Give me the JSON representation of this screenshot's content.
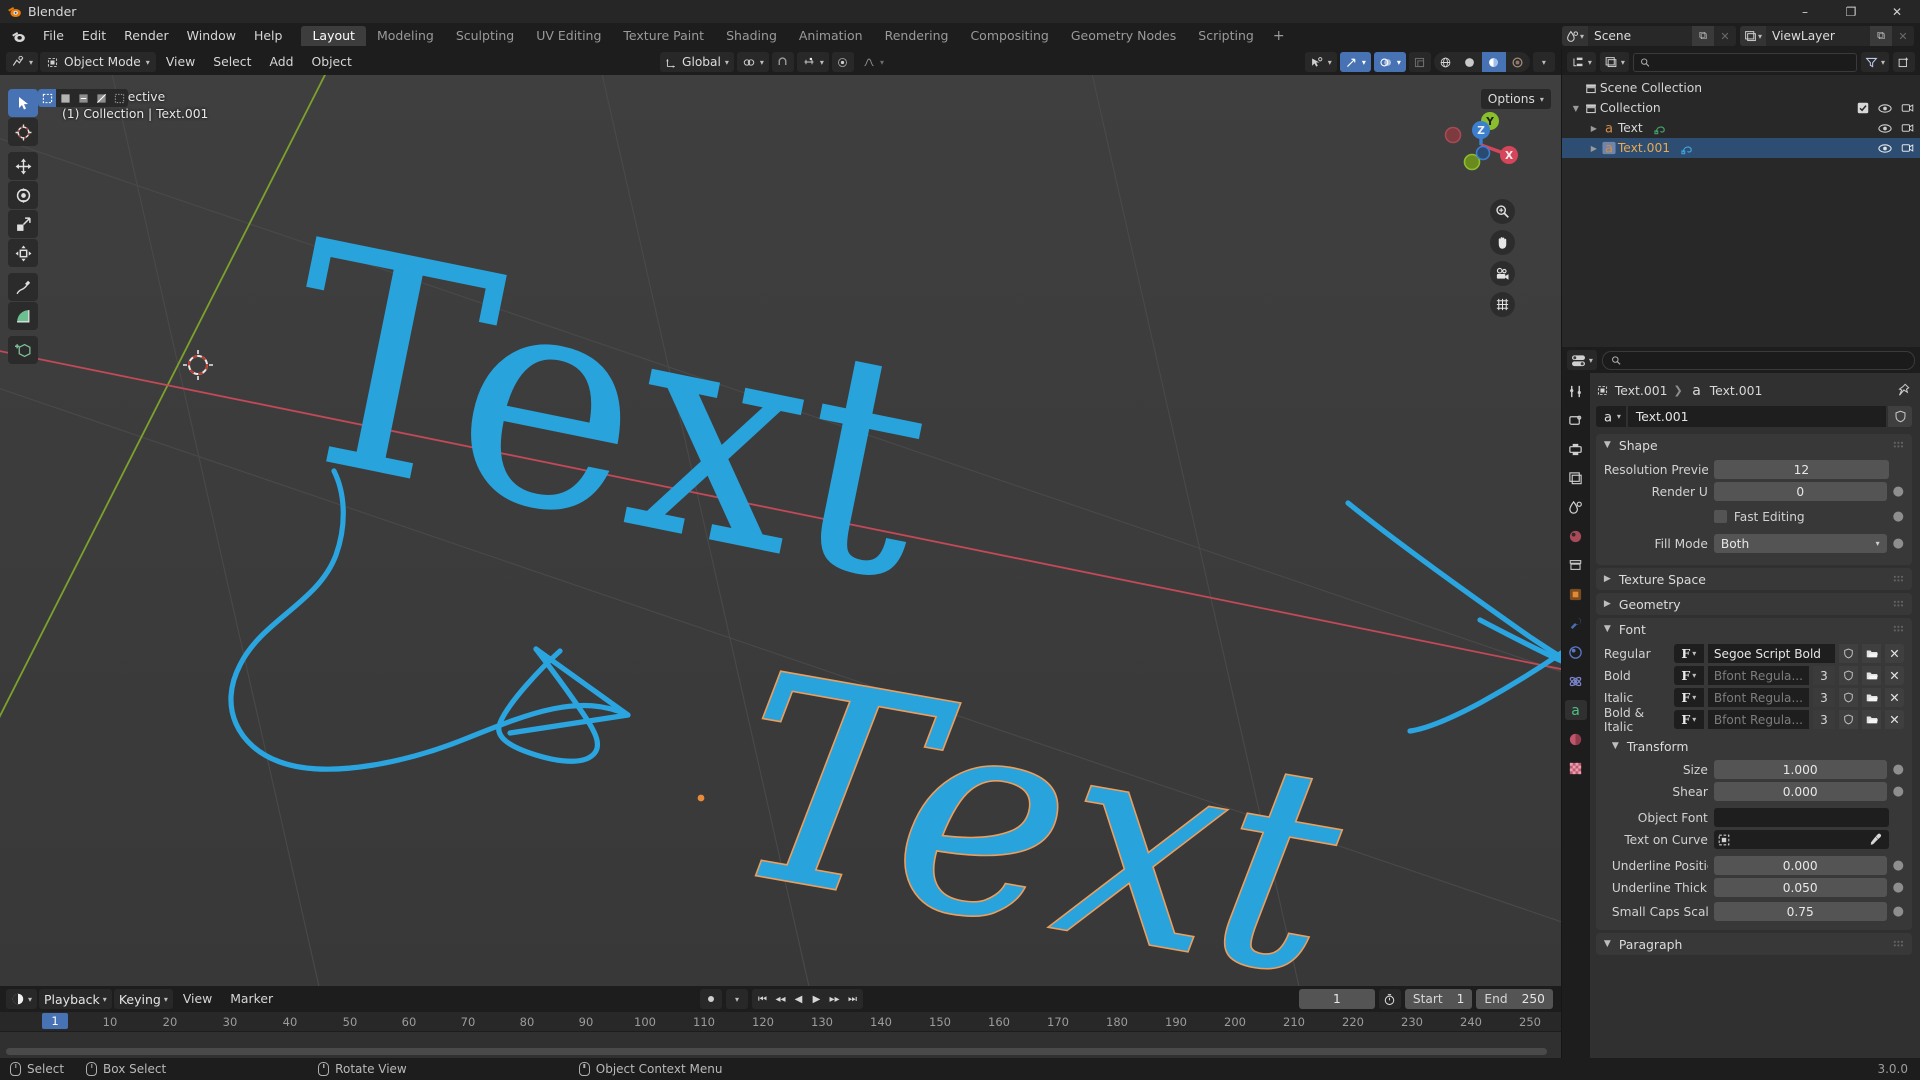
{
  "window": {
    "app_title": "Blender",
    "minimize": "–",
    "maximize": "❐",
    "close": "✕"
  },
  "topbar": {
    "menus": [
      "File",
      "Edit",
      "Render",
      "Window",
      "Help"
    ],
    "workspace_tabs": [
      {
        "label": "Layout",
        "active": true
      },
      {
        "label": "Modeling",
        "active": false
      },
      {
        "label": "Sculpting",
        "active": false
      },
      {
        "label": "UV Editing",
        "active": false
      },
      {
        "label": "Texture Paint",
        "active": false
      },
      {
        "label": "Shading",
        "active": false
      },
      {
        "label": "Animation",
        "active": false
      },
      {
        "label": "Rendering",
        "active": false
      },
      {
        "label": "Compositing",
        "active": false
      },
      {
        "label": "Geometry Nodes",
        "active": false
      },
      {
        "label": "Scripting",
        "active": false
      }
    ],
    "add_workspace": "+",
    "scene_name": "Scene",
    "viewlayer_name": "ViewLayer",
    "new_btn": "⧉",
    "unlink_btn": "✕"
  },
  "viewport": {
    "mode": "Object Mode",
    "menus": [
      "View",
      "Select",
      "Add",
      "Object"
    ],
    "transform_orientation": "Global",
    "overlay_line1": "User Perspective",
    "overlay_line2": "(1) Collection | Text.001",
    "options_label": "Options",
    "gizmo_axes": {
      "x": "X",
      "y": "Y",
      "z": "Z"
    },
    "tools": [
      "tweak-select-tool",
      "cursor-tool",
      "move-tool",
      "rotate-tool",
      "scale-tool",
      "transform-tool",
      "annotate-tool",
      "measure-tool",
      "add-cube-tool"
    ],
    "nav_buttons": [
      "zoom-icon",
      "pan-hand-icon",
      "camera-icon",
      "grid-ortho-icon"
    ]
  },
  "outliner": {
    "search_placeholder": "",
    "rows": [
      {
        "label": "Scene Collection",
        "icon": "collection-icon",
        "depth": 0,
        "selected": false,
        "has_toggle": false,
        "checkbox": false,
        "eye": false,
        "camera": false
      },
      {
        "label": "Collection",
        "icon": "collection-icon",
        "depth": 1,
        "selected": false,
        "has_toggle": true,
        "checkbox": true,
        "eye": true,
        "camera": true
      },
      {
        "label": "Text",
        "icon": "font-a-icon",
        "depth": 2,
        "selected": false,
        "has_toggle": true,
        "checkbox": false,
        "eye": true,
        "camera": true
      },
      {
        "label": "Text.001",
        "icon": "font-a-icon",
        "depth": 2,
        "selected": true,
        "has_toggle": true,
        "checkbox": false,
        "eye": true,
        "camera": true
      }
    ]
  },
  "properties": {
    "search_placeholder": "",
    "breadcrumb": {
      "object": "Text.001",
      "data": "Text.001"
    },
    "id_name": "Text.001",
    "panels": {
      "shape": {
        "title": "Shape",
        "resolution_preview_label": "Resolution Previe...",
        "resolution_preview_value": "12",
        "render_u_label": "Render U",
        "render_u_value": "0",
        "fast_editing_label": "Fast Editing",
        "fill_mode_label": "Fill Mode",
        "fill_mode_value": "Both"
      },
      "texture_space": {
        "title": "Texture Space"
      },
      "geometry": {
        "title": "Geometry"
      },
      "font": {
        "title": "Font",
        "rows": [
          {
            "label": "Regular",
            "value": "Segoe Script Bold",
            "users": "",
            "dim": false
          },
          {
            "label": "Bold",
            "value": "Bfont Regula...",
            "users": "3",
            "dim": true
          },
          {
            "label": "Italic",
            "value": "Bfont Regula...",
            "users": "3",
            "dim": true
          },
          {
            "label": "Bold & Italic",
            "value": "Bfont Regula...",
            "users": "3",
            "dim": true
          }
        ]
      },
      "transform": {
        "title": "Transform",
        "size_label": "Size",
        "size_value": "1.000",
        "shear_label": "Shear",
        "shear_value": "0.000",
        "object_font_label": "Object Font",
        "object_font_value": "",
        "text_on_curve_label": "Text on Curve",
        "text_on_curve_value": "",
        "underline_position_label": "Underline Position",
        "underline_position_value": "0.000",
        "underline_thickness_label": "Underline Thickn...",
        "underline_thickness_value": "0.050",
        "small_caps_scale_label": "Small Caps Scale",
        "small_caps_scale_value": "0.75"
      },
      "paragraph": {
        "title": "Paragraph"
      }
    }
  },
  "timeline": {
    "menus": [
      "Playback",
      "Keying",
      "View",
      "Marker"
    ],
    "current_frame": "1",
    "start_label": "Start",
    "start_value": "1",
    "end_label": "End",
    "end_value": "250",
    "playhead_label": "1",
    "ticks": [
      "10",
      "20",
      "30",
      "40",
      "50",
      "60",
      "70",
      "80",
      "90",
      "100",
      "110",
      "120",
      "130",
      "140",
      "150",
      "160",
      "170",
      "180",
      "190",
      "200",
      "210",
      "220",
      "230",
      "240",
      "250"
    ]
  },
  "statusbar": {
    "items": [
      {
        "label": "Select",
        "icon": "mouse-left-icon"
      },
      {
        "label": "Box Select",
        "icon": "mouse-left-drag-icon"
      },
      {
        "label": "Rotate View",
        "icon": "mouse-middle-icon"
      },
      {
        "label": "Object Context Menu",
        "icon": "mouse-right-icon"
      }
    ],
    "version": "3.0.0"
  },
  "colors": {
    "accent": "#4772b3",
    "text_blue": "#29a3dc",
    "outline_orange": "#ed9e5c",
    "axis_x": "#c84a5a",
    "axis_y": "#7fa82a",
    "bg_viewport": "#3b3b3b"
  }
}
